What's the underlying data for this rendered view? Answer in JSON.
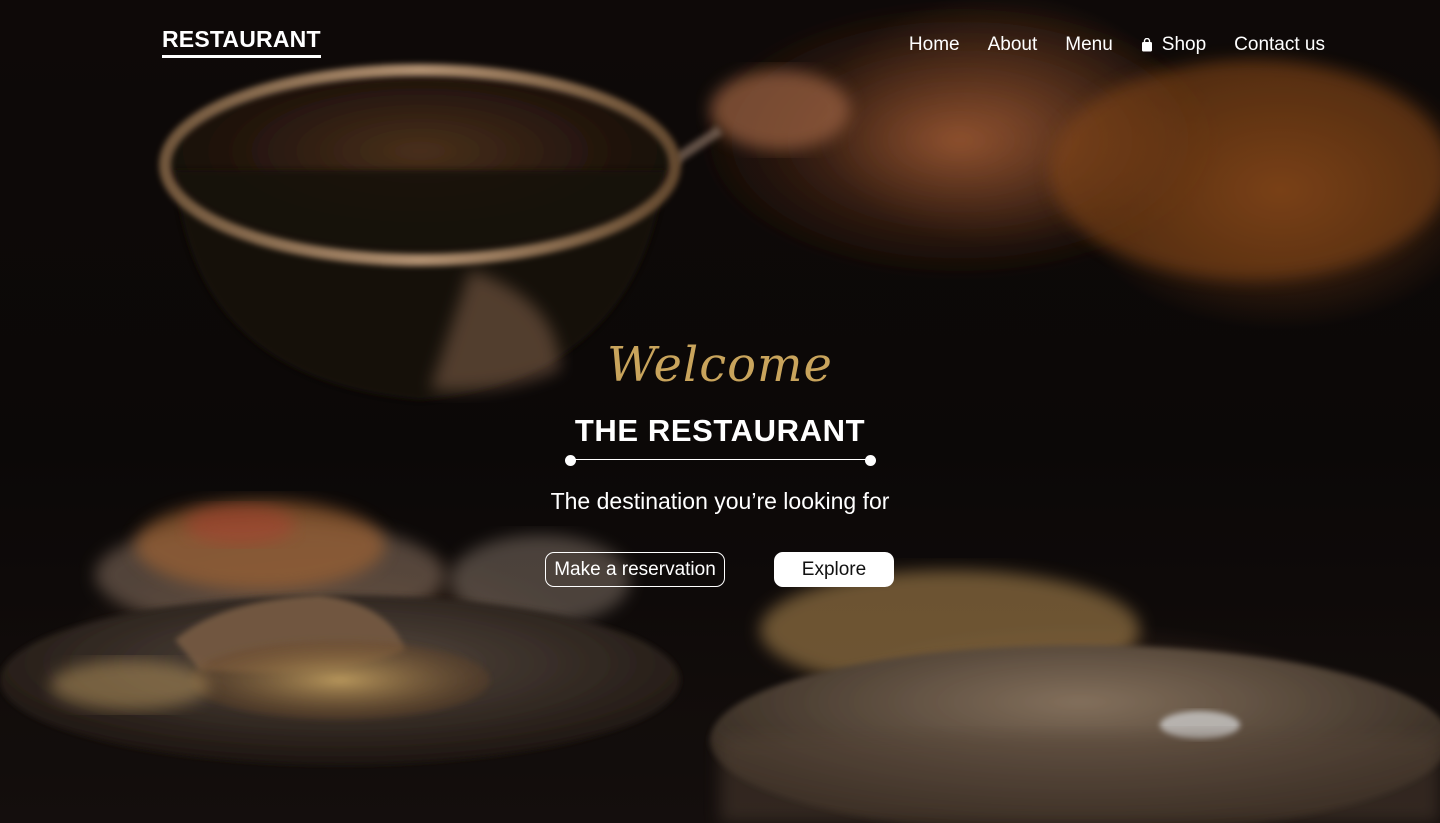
{
  "header": {
    "brand": "RESTAURANT",
    "nav": [
      {
        "label": "Home"
      },
      {
        "label": "About"
      },
      {
        "label": "Menu"
      },
      {
        "label": "Shop",
        "icon": "shopping-bag-icon"
      },
      {
        "label": "Contact us"
      }
    ]
  },
  "hero": {
    "welcome": "Welcome",
    "title": "THE RESTAURANT",
    "tagline": "The destination you’re looking for",
    "buttons": {
      "reserve": "Make a reservation",
      "explore": "Explore"
    }
  },
  "colors": {
    "accent_gold": "#c9a45c",
    "text": "#ffffff",
    "background": "#0d0908"
  }
}
